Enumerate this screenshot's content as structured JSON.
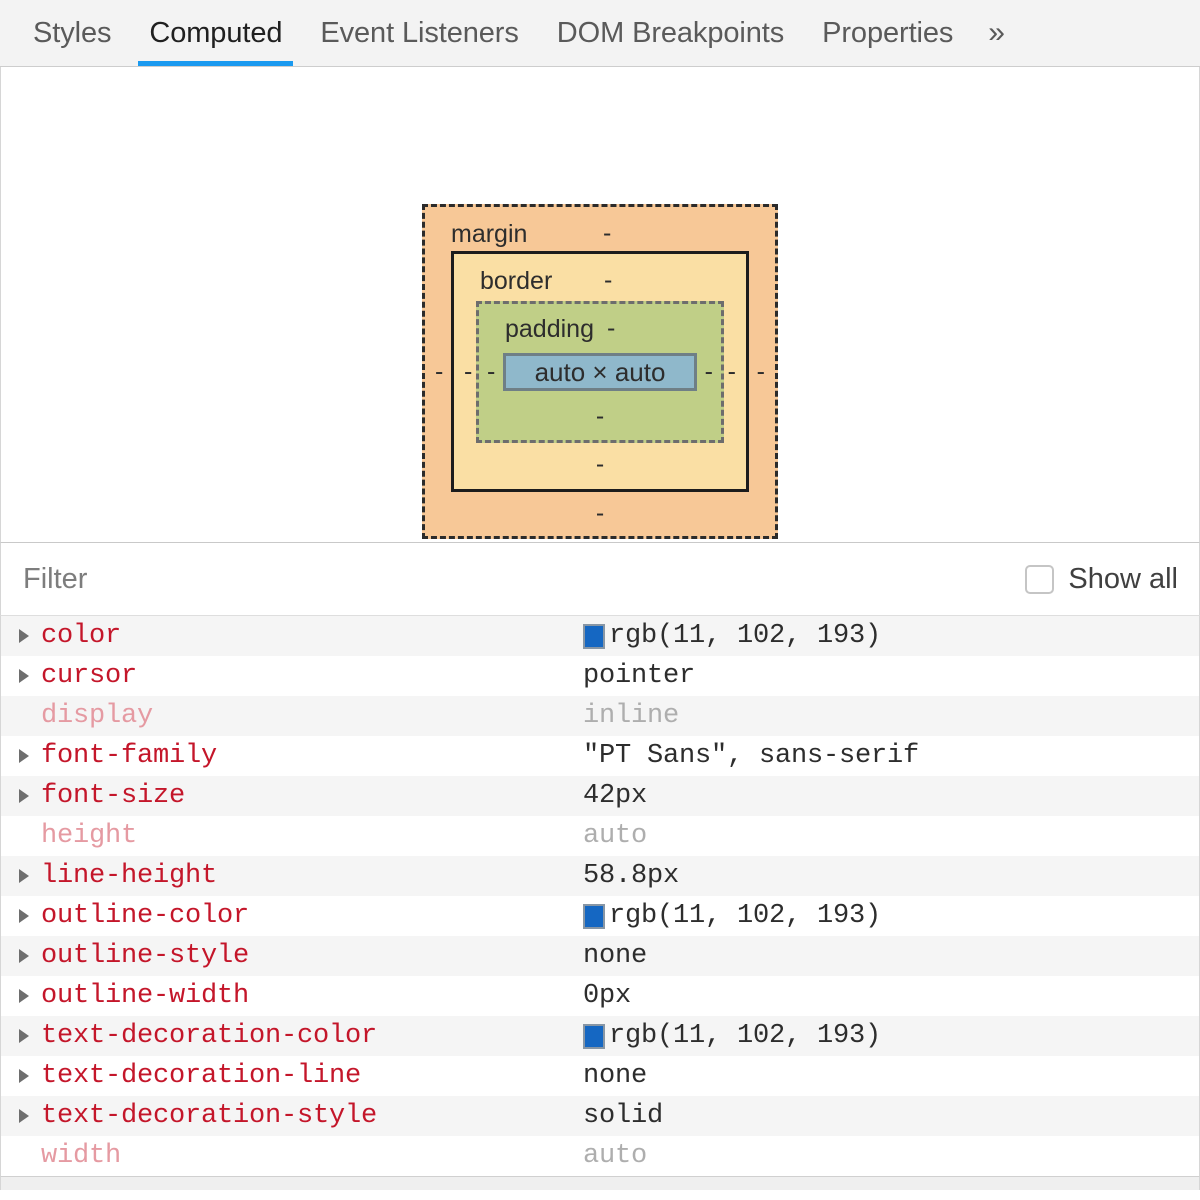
{
  "tabs": [
    {
      "label": "Styles",
      "active": false
    },
    {
      "label": "Computed",
      "active": true
    },
    {
      "label": "Event Listeners",
      "active": false
    },
    {
      "label": "DOM Breakpoints",
      "active": false
    },
    {
      "label": "Properties",
      "active": false
    }
  ],
  "tab_overflow_glyph": "»",
  "box_model": {
    "margin": {
      "label": "margin",
      "top": "-",
      "right": "-",
      "bottom": "-",
      "left": "-"
    },
    "border": {
      "label": "border",
      "top": "-",
      "right": "-",
      "bottom": "-",
      "left": "-"
    },
    "padding": {
      "label": "padding",
      "top": "-",
      "right": "-",
      "bottom": "-",
      "left": "-"
    },
    "content": {
      "text": "auto × auto"
    },
    "colors": {
      "margin": "#f7c897",
      "border": "#fadfa4",
      "padding": "#c0cf87",
      "content": "#8fb8cb"
    }
  },
  "filter": {
    "placeholder": "Filter",
    "value": "",
    "show_all_label": "Show all",
    "show_all_checked": false
  },
  "properties": [
    {
      "name": "color",
      "value": "rgb(11, 102, 193)",
      "swatch": "#1567c2",
      "expandable": true,
      "inherited": false
    },
    {
      "name": "cursor",
      "value": "pointer",
      "swatch": null,
      "expandable": true,
      "inherited": false
    },
    {
      "name": "display",
      "value": "inline",
      "swatch": null,
      "expandable": false,
      "inherited": true
    },
    {
      "name": "font-family",
      "value": "\"PT Sans\", sans-serif",
      "swatch": null,
      "expandable": true,
      "inherited": false
    },
    {
      "name": "font-size",
      "value": "42px",
      "swatch": null,
      "expandable": true,
      "inherited": false
    },
    {
      "name": "height",
      "value": "auto",
      "swatch": null,
      "expandable": false,
      "inherited": true
    },
    {
      "name": "line-height",
      "value": "58.8px",
      "swatch": null,
      "expandable": true,
      "inherited": false
    },
    {
      "name": "outline-color",
      "value": "rgb(11, 102, 193)",
      "swatch": "#1567c2",
      "expandable": true,
      "inherited": false
    },
    {
      "name": "outline-style",
      "value": "none",
      "swatch": null,
      "expandable": true,
      "inherited": false
    },
    {
      "name": "outline-width",
      "value": "0px",
      "swatch": null,
      "expandable": true,
      "inherited": false
    },
    {
      "name": "text-decoration-color",
      "value": "rgb(11, 102, 193)",
      "swatch": "#1567c2",
      "expandable": true,
      "inherited": false
    },
    {
      "name": "text-decoration-line",
      "value": "none",
      "swatch": null,
      "expandable": true,
      "inherited": false
    },
    {
      "name": "text-decoration-style",
      "value": "solid",
      "swatch": null,
      "expandable": true,
      "inherited": false
    },
    {
      "name": "width",
      "value": "auto",
      "swatch": null,
      "expandable": false,
      "inherited": true
    }
  ]
}
